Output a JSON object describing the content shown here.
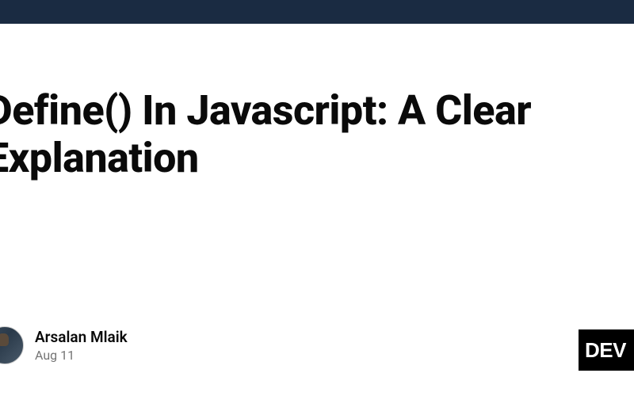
{
  "article": {
    "title": "Define() In Javascript: A Clear Explanation"
  },
  "author": {
    "name": "Arsalan Mlaik",
    "date": "Aug 11"
  },
  "brand": {
    "label": "DEV"
  },
  "colors": {
    "top_bar": "#1a2b42",
    "title": "#0a0a0a",
    "date": "#757575",
    "badge_bg": "#000000",
    "badge_fg": "#ffffff"
  }
}
